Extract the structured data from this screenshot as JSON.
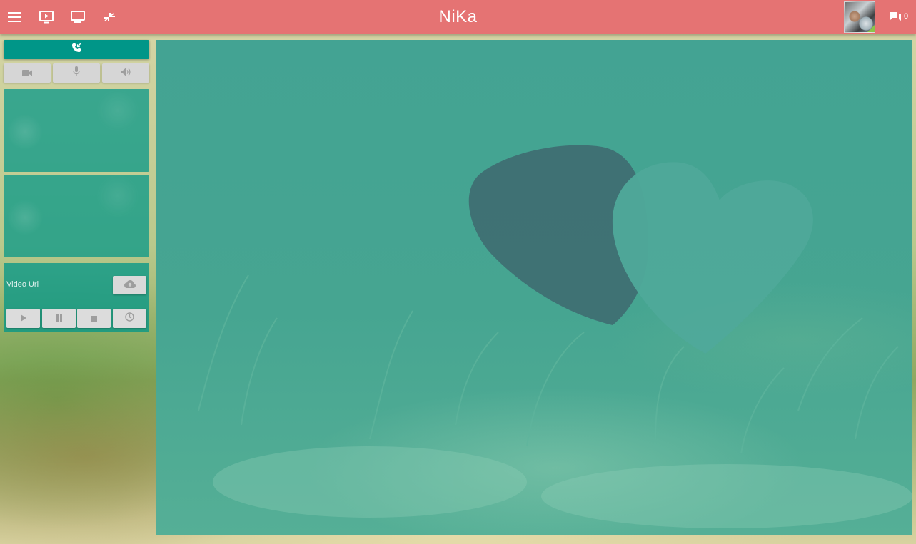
{
  "app": {
    "title": "NiKa"
  },
  "topbar": {
    "icons": [
      "menu-icon",
      "video-player-icon",
      "screen-share-icon",
      "compress-icon"
    ],
    "chat_count": "0"
  },
  "left_panel": {
    "call_button_icon": "phone-incoming-icon",
    "media_buttons": [
      "videocam-icon",
      "mic-icon",
      "volume-icon"
    ],
    "video_url": {
      "placeholder": "Video Url",
      "value": ""
    },
    "upload_icon": "cloud-upload-icon",
    "controls": [
      "play-icon",
      "pause-icon",
      "stop-icon",
      "clock-icon"
    ]
  },
  "colors": {
    "topbar": "#e57373",
    "accent": "#009688",
    "overlay": "#43a393",
    "button_grey": "#d6d6d6"
  }
}
